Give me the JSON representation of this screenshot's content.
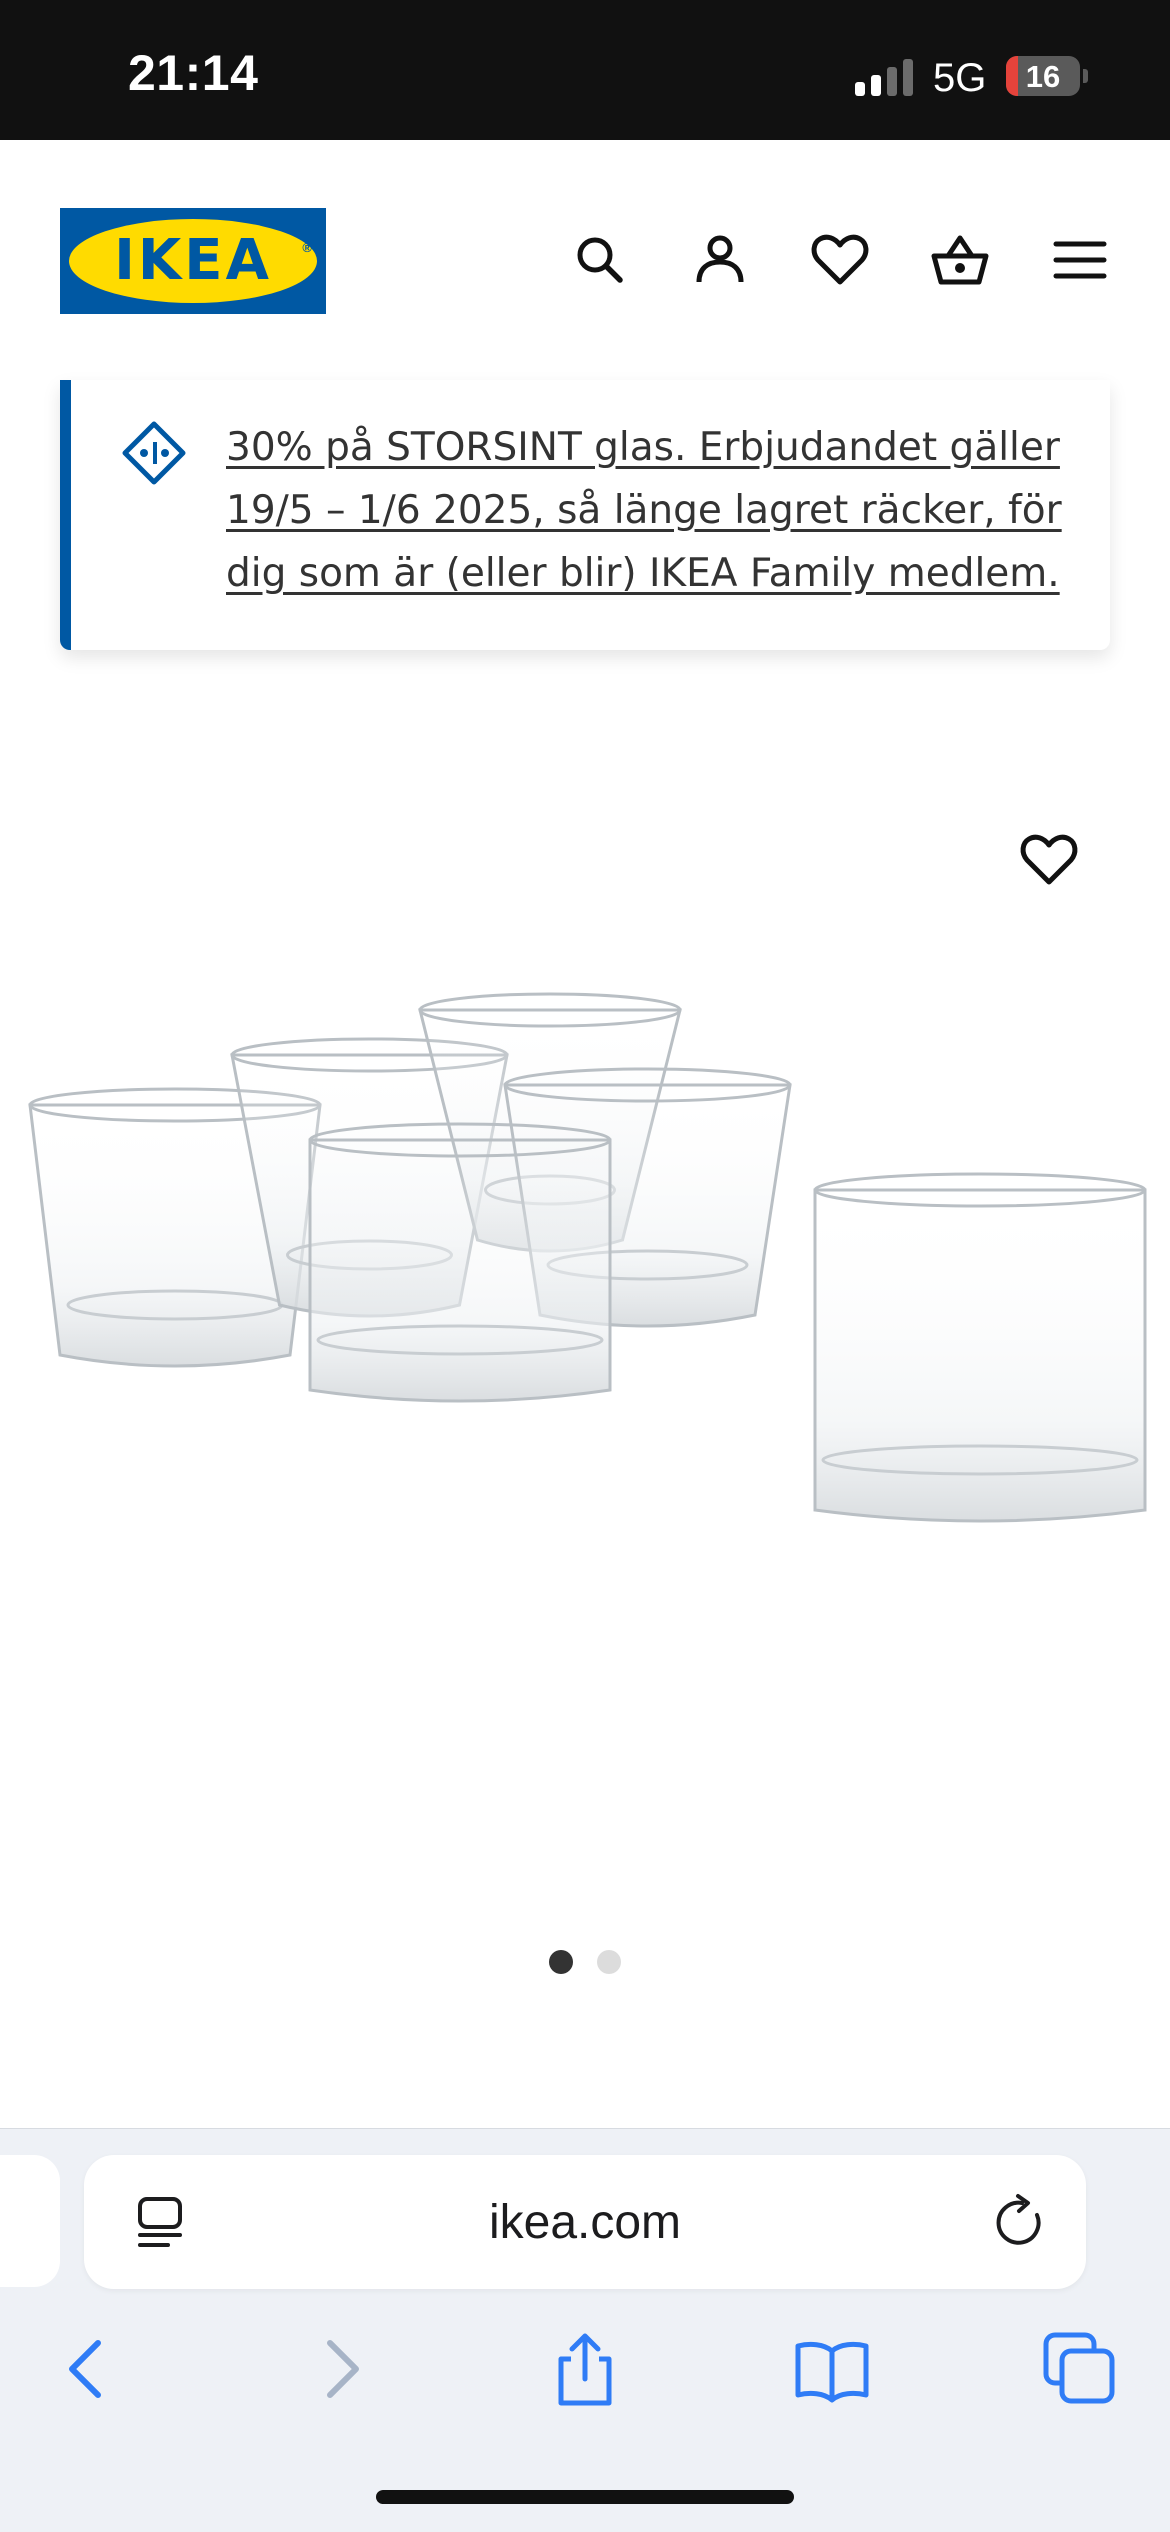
{
  "status_bar": {
    "time": "21:14",
    "network": "5G",
    "battery_level": "16",
    "battery_fraction": 0.16,
    "signal_bars_active": 2,
    "signal_bars_total": 4
  },
  "header": {
    "logo_text": "IKEA",
    "logo_registered": "®",
    "icons": [
      "search-icon",
      "account-icon",
      "favorites-icon",
      "cart-icon",
      "menu-icon"
    ]
  },
  "promo": {
    "icon": "family-tag-icon",
    "text": "30% på STORSINT glas. Erbjudandet gäller 19/5 – 1/6 2025, så länge lagret räcker, för dig som är (eller blir) IKEA Family medlem."
  },
  "product": {
    "image_count": 2,
    "active_image_index": 0,
    "favorite_icon": "heart-icon"
  },
  "safari": {
    "url": "ikea.com",
    "left_icon": "reader-icon",
    "right_icon": "reload-icon",
    "toolbar": [
      "back-icon",
      "forward-icon",
      "share-icon",
      "bookmarks-icon",
      "tabs-icon"
    ]
  },
  "colors": {
    "ikea_blue": "#0058a3",
    "ikea_yellow": "#ffdb00",
    "safari_blue": "#2f7cf6",
    "battery_low": "#e5433b"
  }
}
